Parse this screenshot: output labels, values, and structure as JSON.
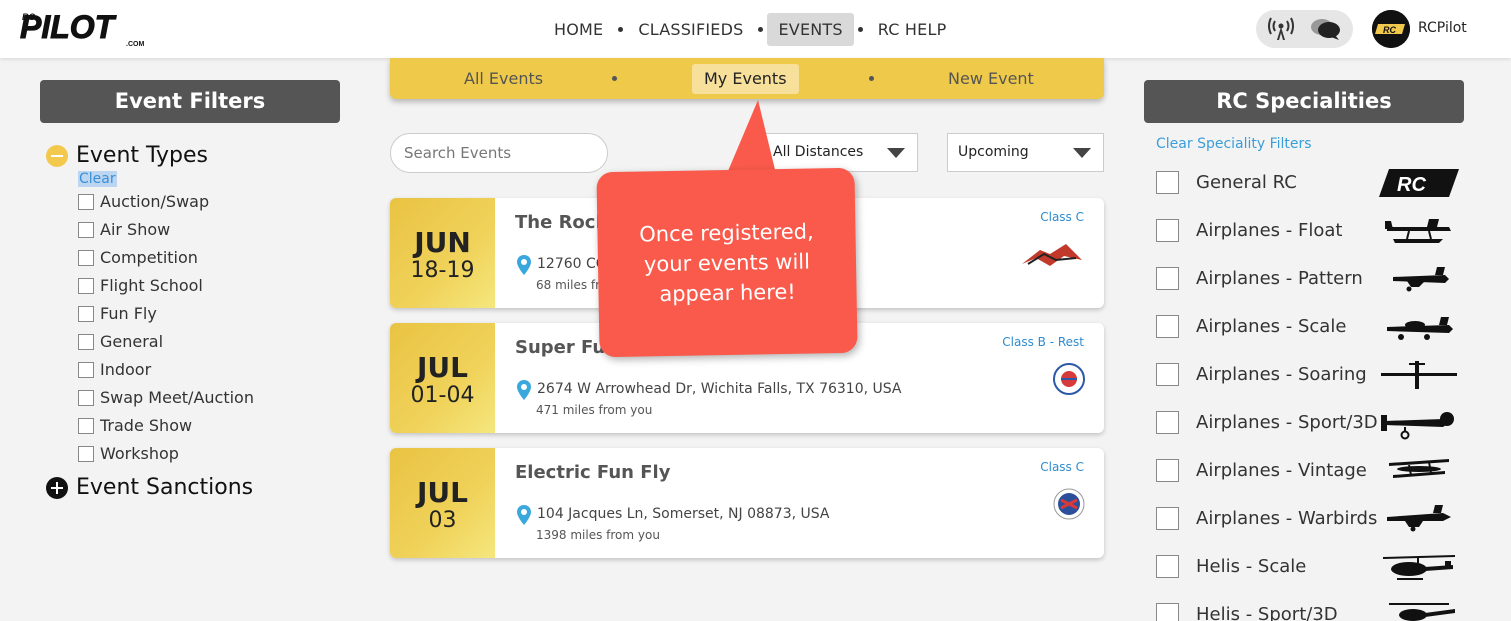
{
  "header": {
    "logo_small": "RC",
    "logo_text": "PILOT",
    "logo_domain": ".COM",
    "nav": [
      {
        "label": "HOME",
        "active": false
      },
      {
        "label": "CLASSIFIEDS",
        "active": false
      },
      {
        "label": "EVENTS",
        "active": true
      },
      {
        "label": "RC HELP",
        "active": false
      }
    ],
    "icons": [
      "signal-icon",
      "chat-icon"
    ],
    "user_name": "RCPilot",
    "avatar_text": "RC"
  },
  "left": {
    "title": "Event Filters",
    "event_types_label": "Event Types",
    "clear_label": "Clear",
    "types": [
      "Auction/Swap",
      "Air Show",
      "Competition",
      "Flight School",
      "Fun Fly",
      "General",
      "Indoor",
      "Swap Meet/Auction",
      "Trade Show",
      "Workshop"
    ],
    "sanctions_label": "Event Sanctions"
  },
  "subnav": {
    "items": [
      "All Events",
      "My Events",
      "New Event"
    ],
    "active": "My Events"
  },
  "search": {
    "placeholder": "Search Events"
  },
  "filters": {
    "distance": "All Distances",
    "time": "Upcoming"
  },
  "events": [
    {
      "month": "JUN",
      "days": "18-19",
      "title": "The Rocky",
      "address": "12760 CO-",
      "miles": "68 miles from",
      "class": "Class C"
    },
    {
      "month": "JUL",
      "days": "01-04",
      "title": "Super Fun",
      "address": "2674 W Arrowhead Dr, Wichita Falls, TX 76310, USA",
      "miles": "471 miles from you",
      "class": "Class B - Rest"
    },
    {
      "month": "JUL",
      "days": "03",
      "title": "Electric Fun Fly",
      "address": "104 Jacques Ln, Somerset, NJ 08873, USA",
      "miles": "1398 miles from you",
      "class": "Class C"
    }
  ],
  "tooltip": {
    "lines": [
      "Once registered,",
      "your events will",
      "appear here!"
    ]
  },
  "right": {
    "title": "RC Specialities",
    "clear_label": "Clear Speciality Filters",
    "specialities": [
      "General RC",
      "Airplanes - Float",
      "Airplanes - Pattern",
      "Airplanes - Scale",
      "Airplanes - Soaring",
      "Airplanes - Sport/3D",
      "Airplanes - Vintage",
      "Airplanes - Warbirds",
      "Helis - Scale",
      "Helis - Sport/3D"
    ],
    "general_badge": "RC"
  },
  "colors": {
    "accent_yellow": "#efc94a",
    "tooltip_red": "#fa5a4b",
    "link_blue": "#3a8fd6",
    "panel_gray": "#555555"
  }
}
